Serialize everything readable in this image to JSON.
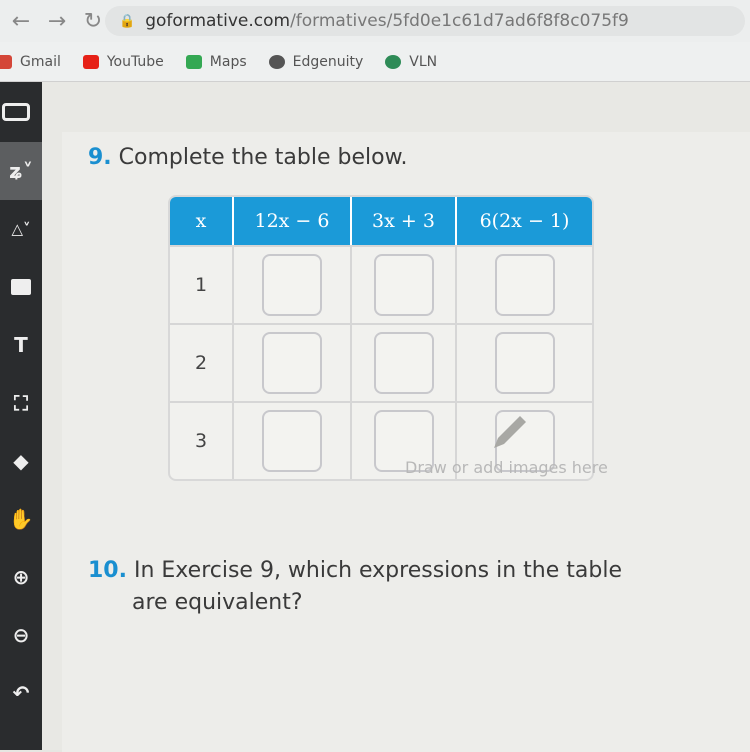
{
  "browser": {
    "url_domain": "goformative.com",
    "url_path": "/formatives/5fd0e1c61d7ad6f8f8c075f9",
    "bookmarks": [
      {
        "label": "Gmail",
        "color": "#d44638"
      },
      {
        "label": "YouTube",
        "color": "#e62117"
      },
      {
        "label": "Maps",
        "color": "#34a853"
      },
      {
        "label": "Edgenuity",
        "color": "#555555"
      },
      {
        "label": "VLN",
        "color": "#2e8b57"
      }
    ]
  },
  "toolbar": {
    "tools": [
      "menu",
      "pen",
      "shapes",
      "image",
      "text",
      "select",
      "eraser",
      "hand",
      "zoom-in",
      "zoom-out",
      "undo"
    ]
  },
  "question9": {
    "number": "9.",
    "text": "Complete the table below.",
    "headers": [
      "x",
      "12x − 6",
      "3x + 3",
      "6(2x − 1)"
    ],
    "rows": [
      {
        "x": "1"
      },
      {
        "x": "2"
      },
      {
        "x": "3"
      }
    ],
    "hint": "Draw or add images here"
  },
  "question10": {
    "number": "10.",
    "line1": "In Exercise 9, which expressions in the table",
    "line2": "are equivalent?"
  },
  "colors": {
    "accent": "#1b9ad8",
    "sidebar": "#2a2c2e"
  }
}
